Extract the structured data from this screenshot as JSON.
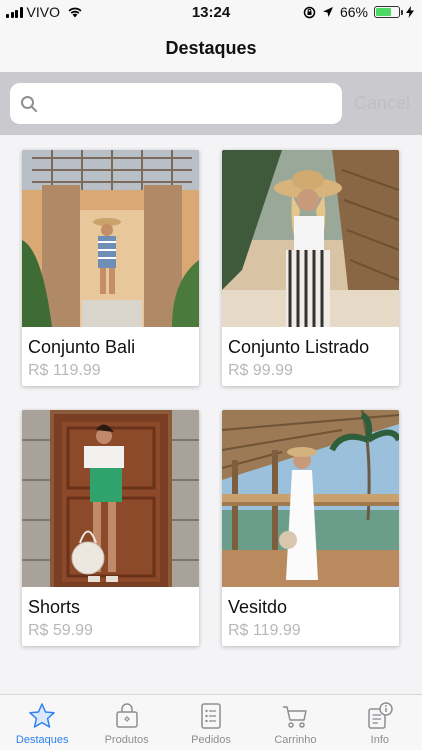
{
  "status_bar": {
    "carrier": "VIVO",
    "time": "13:24",
    "battery": "66%",
    "battery_level": 0.66,
    "battery_color": "#4cd964"
  },
  "nav": {
    "title": "Destaques"
  },
  "search": {
    "placeholder": "",
    "value": "",
    "cancel_label": "Cancel"
  },
  "products": [
    {
      "name": "Conjunto Bali",
      "price": "R$ 119.99",
      "image": "woman-striped-outfit-courtyard-photo"
    },
    {
      "name": "Conjunto Listrado",
      "price": "R$ 99.99",
      "image": "woman-straw-hat-striped-pants-photo"
    },
    {
      "name": "Shorts",
      "price": "R$ 59.99",
      "image": "woman-green-shorts-doorway-photo"
    },
    {
      "name": "Vesitdo",
      "price": "R$ 119.99",
      "image": "woman-white-dress-terrace-photo"
    }
  ],
  "tabs": [
    {
      "label": "Destaques",
      "icon": "star-icon",
      "active": true
    },
    {
      "label": "Produtos",
      "icon": "shopping-bag-icon",
      "active": false
    },
    {
      "label": "Pedidos",
      "icon": "clipboard-list-icon",
      "active": false
    },
    {
      "label": "Carrinho",
      "icon": "cart-icon",
      "active": false
    },
    {
      "label": "Info",
      "icon": "info-icon",
      "active": false
    }
  ],
  "colors": {
    "accent": "#2f80ed",
    "inactive": "#8e8e93",
    "price": "#b8b8bc"
  }
}
